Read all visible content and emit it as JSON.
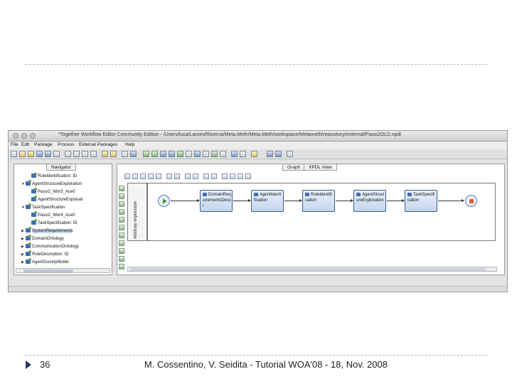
{
  "window": {
    "title": "*Together Workflow Editor Community Edition - /Users/luca/Lavoro/Ricerca/Meta.Meth/Meta.Meth/workspace/Metameth/repository/external/Passi2OLD.xpdl"
  },
  "menu": [
    "File",
    "Edit",
    "Package",
    "Process",
    "External Packages",
    "Help"
  ],
  "navigator": {
    "tab": "Navigator",
    "tree": [
      {
        "label": "RoleIdentification: ID",
        "indent": 3,
        "expander": ""
      },
      {
        "label": "AgentStructureExploration",
        "indent": 2,
        "expander": "open"
      },
      {
        "label": "Passi2_Wor3_Ace0",
        "indent": 3,
        "expander": ""
      },
      {
        "label": "AgentStructureExplorati",
        "indent": 3,
        "expander": ""
      },
      {
        "label": "TaskSpecification",
        "indent": 2,
        "expander": "open"
      },
      {
        "label": "Passi2_Wor4_Ace0",
        "indent": 3,
        "expander": ""
      },
      {
        "label": "TaskSpecification: ID",
        "indent": 3,
        "expander": ""
      },
      {
        "label": "SystemRequirements",
        "indent": 2,
        "expander": "closed",
        "selected": true
      },
      {
        "label": "DomainOntology",
        "indent": 2,
        "expander": "closed"
      },
      {
        "label": "CommunicationOntology",
        "indent": 2,
        "expander": "closed"
      },
      {
        "label": "RoleDescription: ID",
        "indent": 2,
        "expander": "closed"
      },
      {
        "label": "AgentSocietyModel",
        "indent": 2,
        "expander": "closed"
      }
    ]
  },
  "graph": {
    "tabs": [
      "Graph",
      "XPDL View"
    ],
    "lane_label": "Arbitrary expression",
    "activities": [
      {
        "text": "DomainRequirementsDescr"
      },
      {
        "text": "AgentIdentification"
      },
      {
        "text": "RoleIdentification"
      },
      {
        "text": "AgentStructureExploration"
      },
      {
        "text": "TaskSpecification"
      }
    ]
  },
  "footer": {
    "slide_number": "36",
    "text": "M. Cossentino, V. Seidita - Tutorial WOA'08 - 18, Nov. 2008",
    "bullet_color": "#1f3a66"
  }
}
